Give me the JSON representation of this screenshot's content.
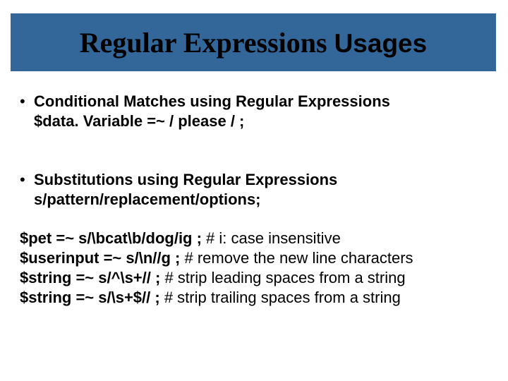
{
  "title": {
    "part1": "Regular Expressions ",
    "part2": "Usages"
  },
  "bullets": [
    {
      "heading": "Conditional Matches using Regular Expressions",
      "sub": "$data. Variable =~ / please / ;"
    },
    {
      "heading": "Substitutions using Regular Expressions",
      "sub": "s/pattern/replacement/options;"
    }
  ],
  "code": [
    {
      "lead": "$pet =~ s/\\bcat\\b/dog/ig ;   ",
      "trail": "# i: case insensitive"
    },
    {
      "lead": "$userinput =~ s/\\n//g ;        ",
      "trail": "# remove the new line characters"
    },
    {
      "lead": "$string =~ s/^\\s+// ;   ",
      "trail": "# strip leading spaces from a string"
    },
    {
      "lead": "$string =~ s/\\s+$// ;   ",
      "trail": "# strip trailing spaces from a string"
    }
  ]
}
